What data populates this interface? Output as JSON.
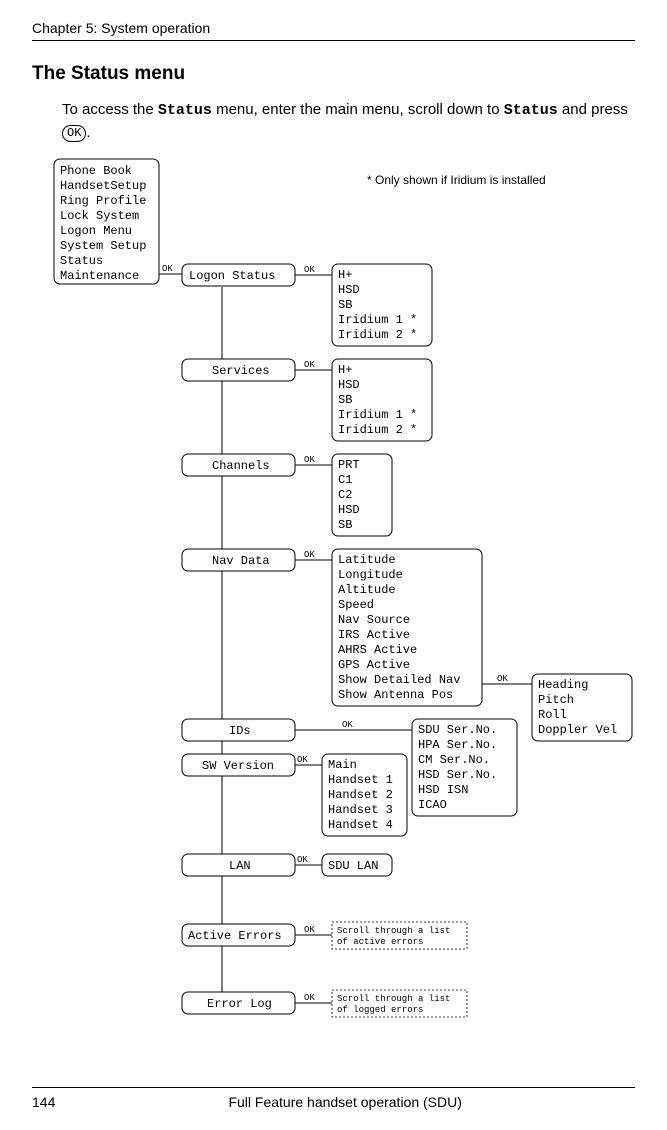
{
  "chapter": "Chapter 5:  System operation",
  "section_title": "The Status menu",
  "body_prefix": "To access the ",
  "body_code1": "Status",
  "body_mid": " menu, enter the main menu, scroll down to ",
  "body_code2": "Status",
  "body_after": " and press ",
  "ok_label": "OK",
  "body_end": ".",
  "note": "* Only shown if Iridium is installed",
  "main_menu": [
    "Phone Book",
    "HandsetSetup",
    "Ring Profile",
    "Lock System",
    "Logon Menu",
    "System Setup",
    "Status",
    "Maintenance"
  ],
  "nodes": {
    "logon_status": "Logon Status",
    "services": "Services",
    "channels": "Channels",
    "nav_data": "Nav Data",
    "ids": "IDs",
    "sw_version": "SW Version",
    "lan": "LAN",
    "active_errors": "Active Errors",
    "error_log": "Error Log"
  },
  "sub_logon": [
    "H+",
    "HSD",
    "SB",
    "Iridium 1 *",
    "Iridium 2 *"
  ],
  "sub_services": [
    "H+",
    "HSD",
    "SB",
    "Iridium 1 *",
    "Iridium 2 *"
  ],
  "sub_channels": [
    "PRT",
    "C1",
    "C2",
    "HSD",
    "SB"
  ],
  "sub_nav": [
    "Latitude",
    "Longitude",
    "Altitude",
    "Speed",
    "Nav Source",
    "IRS Active",
    "AHRS Active",
    "GPS Active",
    "Show Detailed Nav",
    "Show Antenna Pos"
  ],
  "sub_nav2": [
    "Heading",
    "Pitch",
    "Roll",
    "Doppler Vel"
  ],
  "sub_ids": [
    "SDU Ser.No.",
    "HPA Ser.No.",
    "CM Ser.No.",
    "HSD Ser.No.",
    "HSD ISN",
    "ICAO"
  ],
  "sub_sw": [
    "Main",
    "Handset 1",
    "Handset 2",
    "Handset 3",
    "Handset 4"
  ],
  "sub_lan": [
    "SDU LAN"
  ],
  "hint_active": [
    "Scroll through a list",
    "of active errors"
  ],
  "hint_log": [
    "Scroll through a list",
    "of logged errors"
  ],
  "page_number": "144",
  "footer_title": "Full Feature handset operation (SDU)"
}
